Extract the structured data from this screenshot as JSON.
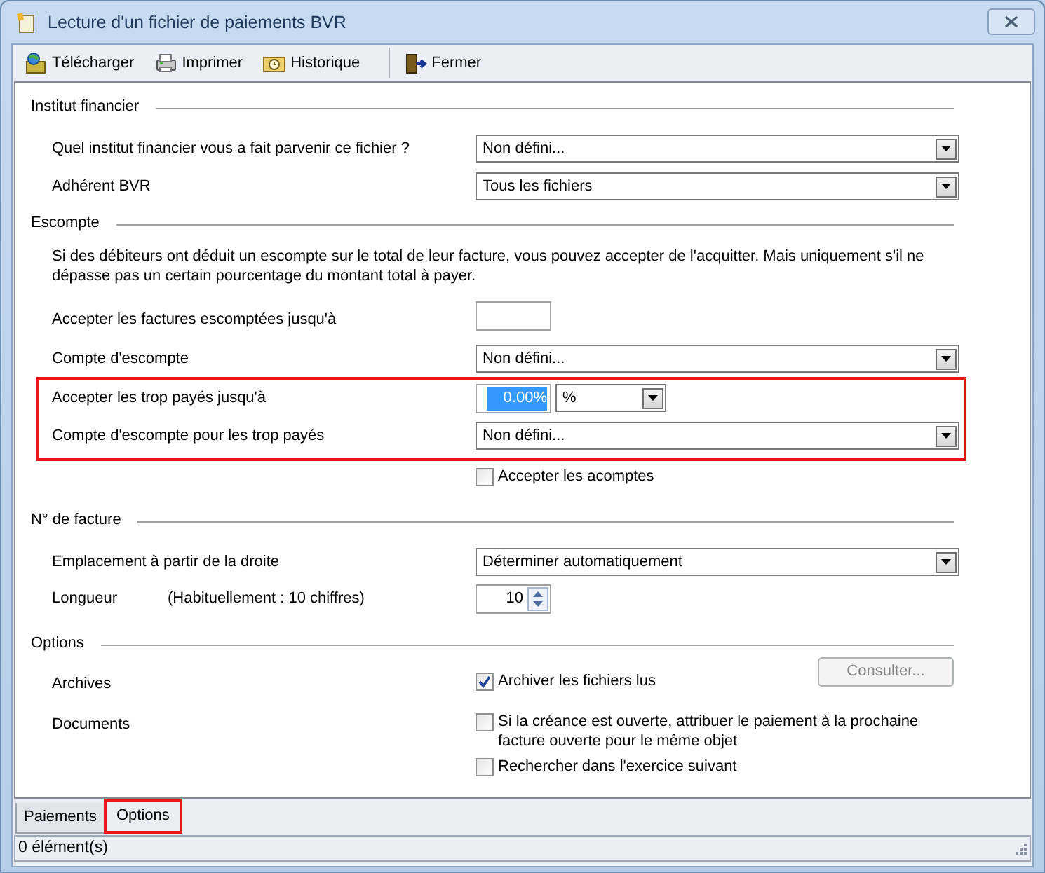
{
  "window": {
    "title": "Lecture d'un fichier de paiements BVR"
  },
  "toolbar": [
    {
      "kind": "download",
      "label": "Télécharger"
    },
    {
      "kind": "print",
      "label": "Imprimer"
    },
    {
      "kind": "history",
      "label": "Historique"
    },
    {
      "kind": "exit",
      "label": "Fermer"
    }
  ],
  "sections": [
    {
      "title": "Institut financier",
      "rows": [
        {
          "kind": "select",
          "label": "Quel institut financier vous a fait parvenir ce fichier ?",
          "value": "Non défini...",
          "highlighted": false
        },
        {
          "kind": "select",
          "label": "Adhérent BVR",
          "value": "Tous les fichiers",
          "highlighted": false
        }
      ]
    },
    {
      "title": "Escompte",
      "rows": [
        {
          "kind": "description",
          "text": "Si des débiteurs ont déduit un escompte sur le total de leur facture, vous pouvez accepter de l'acquitter. Mais uniquement s'il ne dépasse pas un certain pourcentage du montant total à payer.",
          "highlighted": false
        },
        {
          "kind": "text",
          "label": "Accepter les factures escomptées jusqu'à",
          "highlighted": false
        },
        {
          "kind": "select",
          "label": "Compte d'escompte",
          "value": "Non défini...",
          "highlighted": false
        },
        {
          "kind": "percent",
          "label": "Accepter les trop payés jusqu'à",
          "value": "0.00%",
          "text_selected": true,
          "unit": "%",
          "highlighted": true
        },
        {
          "kind": "select",
          "label": "Compte d'escompte pour les trop payés",
          "value": "Non défini...",
          "highlighted": true
        },
        {
          "kind": "checkbox",
          "text": "Accepter les acomptes",
          "checked": false,
          "highlighted": false
        }
      ]
    },
    {
      "title": "N° de facture",
      "rows": [
        {
          "kind": "select",
          "label": "Emplacement à partir de la droite",
          "value": "Déterminer automatiquement",
          "highlighted": false
        },
        {
          "kind": "spin",
          "label": "Longueur",
          "hint": "(Habituellement : 10 chiffres)",
          "value": "10",
          "highlighted": false
        }
      ]
    },
    {
      "title": "Options",
      "rows": [
        {
          "kind": "checkbox",
          "label": "Archives",
          "text": "Archiver les fichiers lus",
          "checked": true,
          "button": {
            "label": "Consulter...",
            "disabled": true
          },
          "highlighted": false
        },
        {
          "kind": "checkbox",
          "label": "Documents",
          "text": "Si la créance est ouverte, attribuer le paiement à la prochaine facture ouverte pour le même objet",
          "checked": false,
          "highlighted": false
        },
        {
          "kind": "checkbox",
          "text": "Rechercher dans l'exercice suivant",
          "checked": false,
          "highlighted": false
        }
      ]
    }
  ],
  "tabs": [
    {
      "label": "Paiements",
      "selected": false,
      "highlighted": false
    },
    {
      "label": "Options",
      "selected": true,
      "highlighted": true
    }
  ],
  "status_bar": "0 élément(s)"
}
